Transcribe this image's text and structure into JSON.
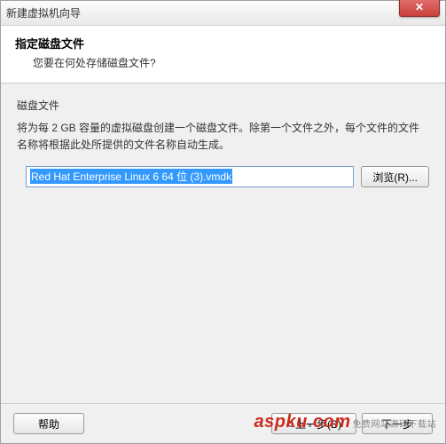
{
  "window": {
    "title": "新建虚拟机向导",
    "close": "✕"
  },
  "header": {
    "title": "指定磁盘文件",
    "subtitle": "您要在何处存储磁盘文件?"
  },
  "section": {
    "label": "磁盘文件",
    "description": "将为每 2 GB 容量的虚拟磁盘创建一个磁盘文件。除第一个文件之外，每个文件的文件名称将根据此处所提供的文件名称自动生成。"
  },
  "file": {
    "value": "Red Hat Enterprise Linux 6 64 位 (3).vmdk",
    "browse_label": "浏览(R)..."
  },
  "footer": {
    "help": "帮助",
    "back": "< 上一步(B)",
    "next": "下一步"
  },
  "watermark": {
    "main": "aspku",
    "dot": ".",
    "com": "com",
    "sub": "免费网站源码下载站"
  }
}
